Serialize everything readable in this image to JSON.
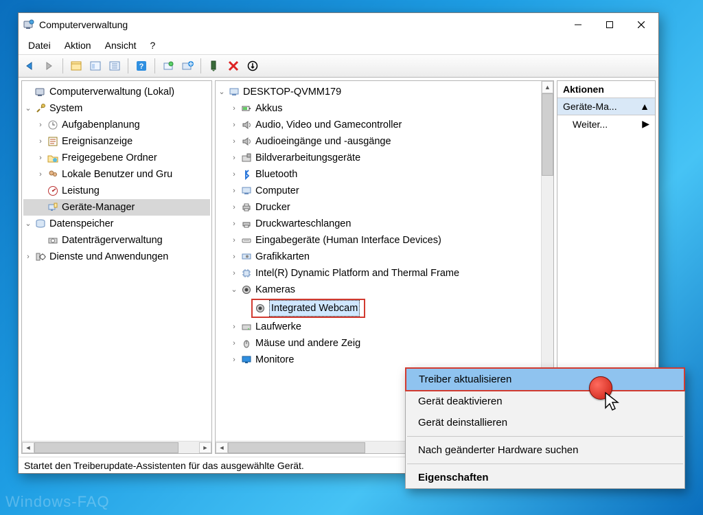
{
  "window": {
    "title": "Computerverwaltung",
    "menus": {
      "file": "Datei",
      "action": "Aktion",
      "view": "Ansicht",
      "help": "?"
    }
  },
  "left_tree": {
    "root": "Computerverwaltung (Lokal)",
    "system": "System",
    "system_children": [
      "Aufgabenplanung",
      "Ereignisanzeige",
      "Freigegebene Ordner",
      "Lokale Benutzer und Gru",
      "Leistung",
      "Geräte-Manager"
    ],
    "storage": "Datenspeicher",
    "storage_children": [
      "Datenträgerverwaltung"
    ],
    "services": "Dienste und Anwendungen"
  },
  "mid_tree": {
    "root": "DESKTOP-QVMM179",
    "cats": [
      "Akkus",
      "Audio, Video und Gamecontroller",
      "Audioeingänge und -ausgänge",
      "Bildverarbeitungsgeräte",
      "Bluetooth",
      "Computer",
      "Drucker",
      "Druckwarteschlangen",
      "Eingabegeräte (Human Interface Devices)",
      "Grafikkarten",
      "Intel(R) Dynamic Platform and Thermal Frame"
    ],
    "cameras": "Kameras",
    "camera_device": "Integrated Webcam",
    "rest": [
      "Laufwerke",
      "Mäuse und andere Zeig",
      "Monitore"
    ]
  },
  "actions": {
    "header": "Aktionen",
    "selected": "Geräte-Ma...",
    "more": "Weiter..."
  },
  "context_menu": {
    "items": [
      "Treiber aktualisieren",
      "Gerät deaktivieren",
      "Gerät deinstallieren"
    ],
    "scan": "Nach geänderter Hardware suchen",
    "props": "Eigenschaften"
  },
  "status": "Startet den Treiberupdate-Assistenten für das ausgewählte Gerät.",
  "watermark": "Windows-FAQ"
}
